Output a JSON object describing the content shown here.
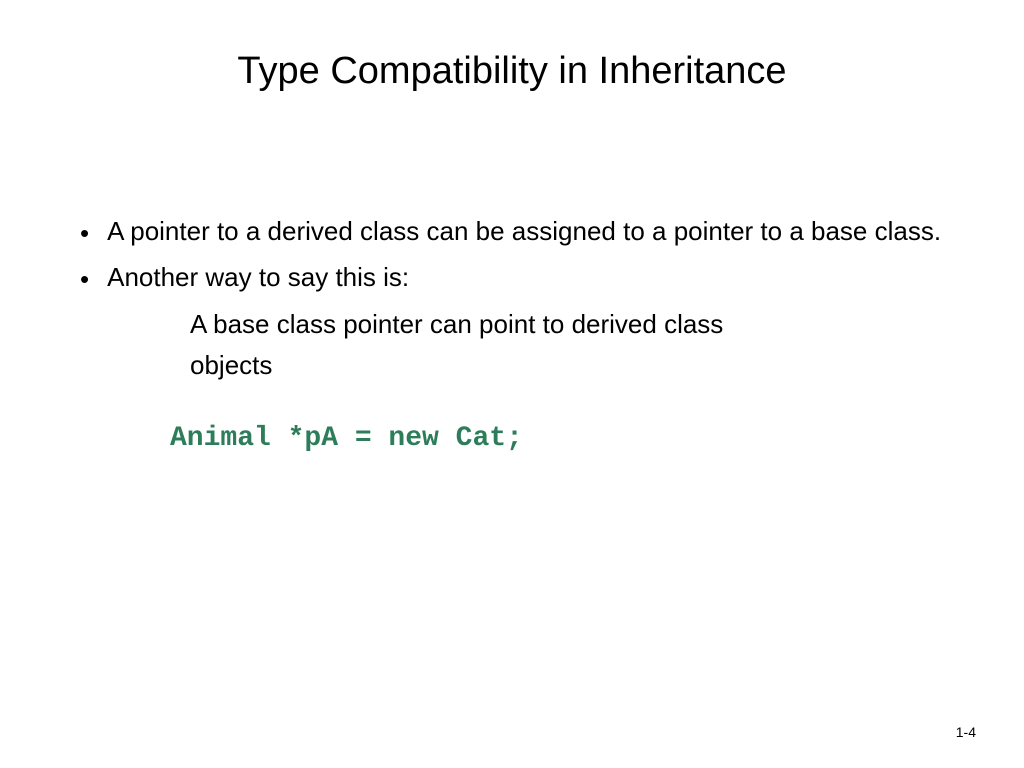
{
  "slide": {
    "title": "Type Compatibility in Inheritance",
    "bullets": [
      {
        "text": "A pointer to a derived class can be assigned to a pointer to a base class."
      },
      {
        "text": "Another way to say this is:"
      }
    ],
    "subtext_lines": [
      "A base class pointer can point to derived class",
      "objects"
    ],
    "code": "Animal *pA = new Cat;",
    "page_number": "1-4"
  }
}
